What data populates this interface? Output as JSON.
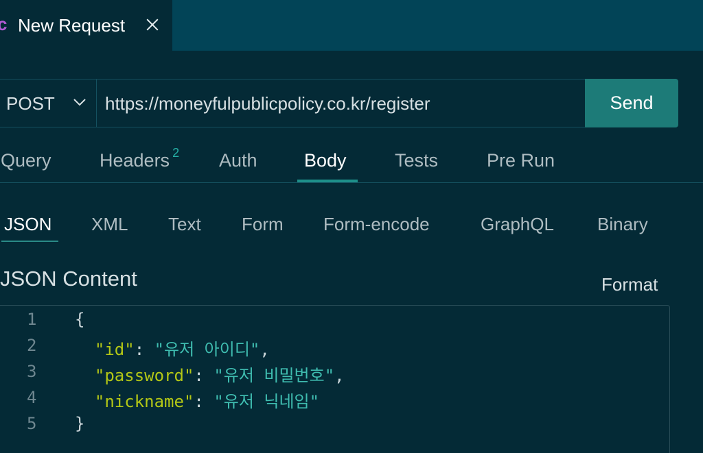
{
  "tab": {
    "method_letter": "c",
    "title": "New Request",
    "close_icon": "close-icon"
  },
  "request": {
    "method": "POST",
    "url": "https://moneyfulpublicpolicy.co.kr/register",
    "send_label": "Send"
  },
  "request_tabs": [
    {
      "label": "Query"
    },
    {
      "label": "Headers",
      "badge": "2"
    },
    {
      "label": "Auth"
    },
    {
      "label": "Body",
      "active": true
    },
    {
      "label": "Tests"
    },
    {
      "label": "Pre Run"
    }
  ],
  "body_tabs": [
    {
      "label": "JSON",
      "active": true
    },
    {
      "label": "XML"
    },
    {
      "label": "Text"
    },
    {
      "label": "Form"
    },
    {
      "label": "Form-encode"
    },
    {
      "label": "GraphQL"
    },
    {
      "label": "Binary"
    }
  ],
  "content": {
    "heading": "JSON Content",
    "format_label": "Format"
  },
  "editor": {
    "lines": [
      {
        "num": "1",
        "tokens": [
          {
            "t": "punc",
            "v": "{"
          }
        ]
      },
      {
        "num": "2",
        "tokens": [
          {
            "t": "punc",
            "v": "  "
          },
          {
            "t": "key",
            "v": "\"id\""
          },
          {
            "t": "punc",
            "v": ": "
          },
          {
            "t": "str",
            "v": "\"유저 아이디\""
          },
          {
            "t": "punc",
            "v": ","
          }
        ]
      },
      {
        "num": "3",
        "tokens": [
          {
            "t": "punc",
            "v": "  "
          },
          {
            "t": "key",
            "v": "\"password\""
          },
          {
            "t": "punc",
            "v": ": "
          },
          {
            "t": "str",
            "v": "\"유저 비밀번호\""
          },
          {
            "t": "punc",
            "v": ","
          }
        ]
      },
      {
        "num": "4",
        "tokens": [
          {
            "t": "punc",
            "v": "  "
          },
          {
            "t": "key",
            "v": "\"nickname\""
          },
          {
            "t": "punc",
            "v": ": "
          },
          {
            "t": "str",
            "v": "\"유저 닉네임\""
          }
        ]
      },
      {
        "num": "5",
        "tokens": [
          {
            "t": "punc",
            "v": "}"
          }
        ]
      }
    ]
  },
  "colors": {
    "background": "#042a36",
    "tabbar": "#024457",
    "accent": "#1d7b78",
    "json_key": "#b3c716",
    "json_string": "#3fbdb0",
    "method_letter": "#b45bd6"
  }
}
